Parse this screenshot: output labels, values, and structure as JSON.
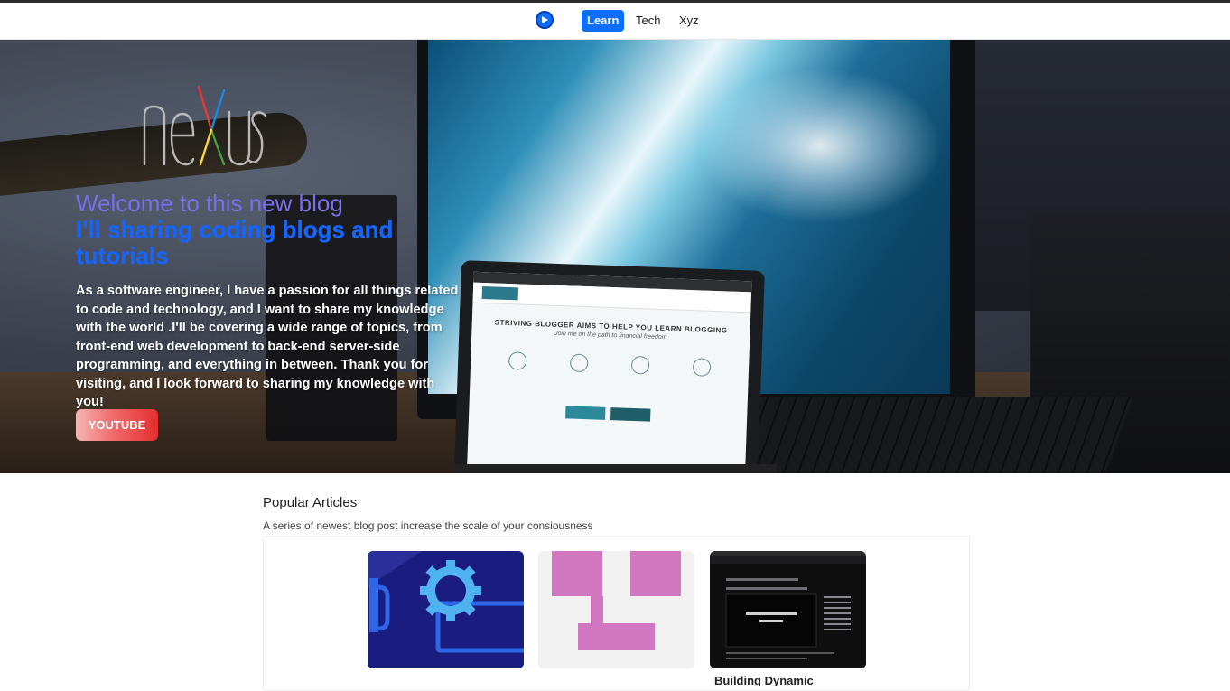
{
  "nav": {
    "logo_icon": "play-circle-icon",
    "links": [
      {
        "label": "Learn",
        "active": true
      },
      {
        "label": "Tech",
        "active": false
      },
      {
        "label": "Xyz",
        "active": false
      }
    ],
    "accent": "#0d6efd"
  },
  "hero": {
    "logo_text": "nexus",
    "welcome": "Welcome to this new blog",
    "tagline": "I'll sharing coding blogs and tutorials",
    "intro": "As a software engineer, I have a passion for all things related to code and technology, and I want to share my knowledge with the world .I'll be covering a wide range of topics, from front-end web development to back-end server-side programming, and everything in between. Thank you for visiting, and I look forward to sharing my knowledge with you!",
    "button_label": "YOUTUBE"
  },
  "popular": {
    "title": "Popular Articles",
    "subtitle": "A series of newest blog post increase the scale of your consiousness",
    "cards": [
      {
        "image": "gear-code-illustration",
        "title": ""
      },
      {
        "image": "pink-pixel-illustration",
        "title": ""
      },
      {
        "image": "nextjs-course-screenshot",
        "title": "Building Dynamic"
      }
    ]
  }
}
